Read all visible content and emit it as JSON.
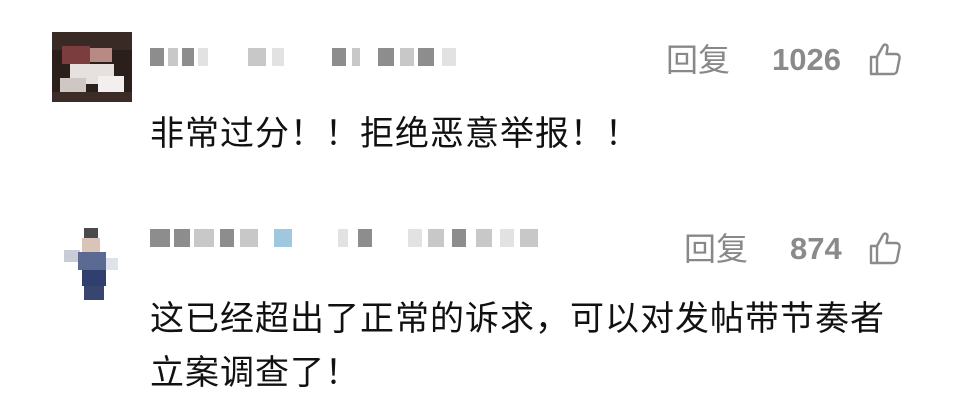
{
  "comments": [
    {
      "reply_label": "回复",
      "likes": "1026",
      "text": "非常过分！！拒绝恶意举报！！",
      "username_icon": "pixelated-username",
      "avatar_icon": "pixelated-avatar"
    },
    {
      "reply_label": "回复",
      "likes": "874",
      "text": "这已经超出了正常的诉求，可以对发帖带节奏者立案调查了！",
      "username_icon": "pixelated-username",
      "avatar_icon": "pixelated-avatar"
    }
  ],
  "colors": {
    "secondary_text": "#888888",
    "main_text": "#111111",
    "background": "#ffffff"
  },
  "icons": {
    "like": "thumbs-up-icon"
  }
}
